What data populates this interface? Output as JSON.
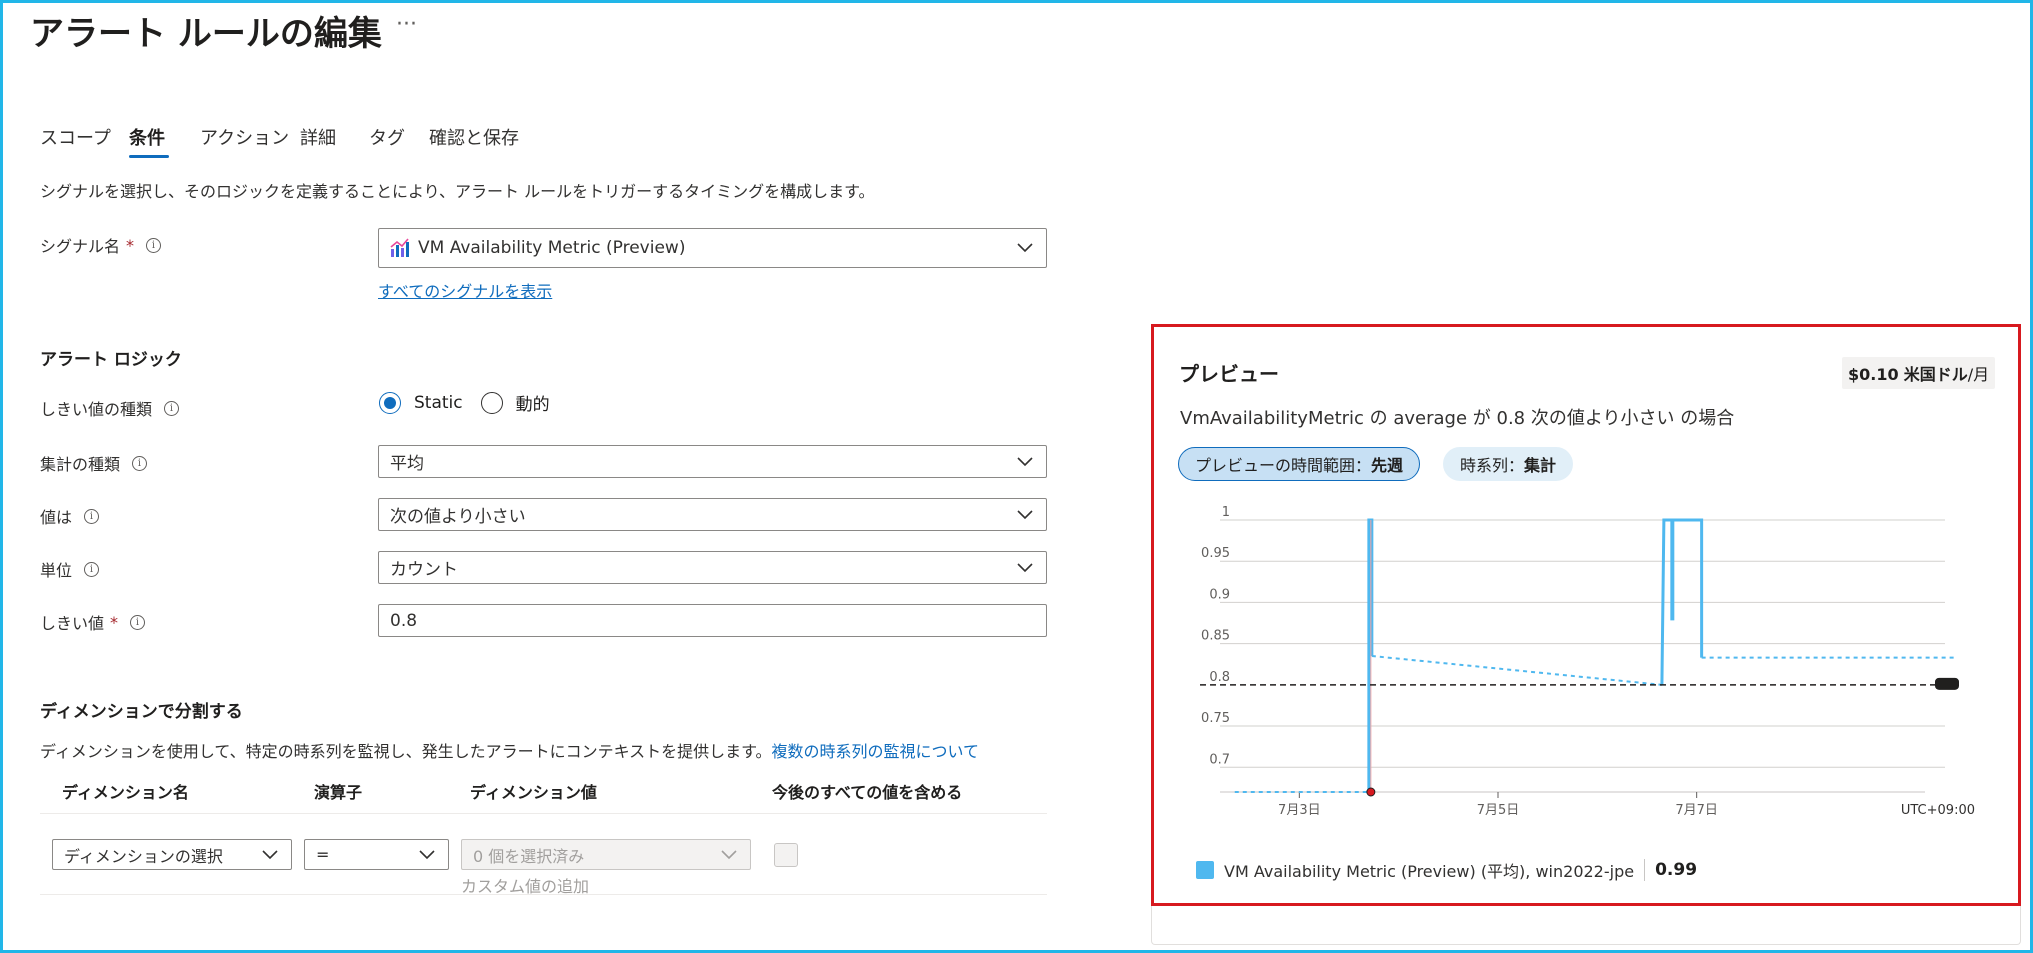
{
  "header": {
    "title": "アラート ルールの編集",
    "more": "···"
  },
  "tabs": [
    {
      "label": "スコープ"
    },
    {
      "label": "条件"
    },
    {
      "label": "アクション"
    },
    {
      "label": "詳細"
    },
    {
      "label": "タグ"
    },
    {
      "label": "確認と保存"
    }
  ],
  "intro": "シグナルを選択し、そのロジックを定義することにより、アラート ルールをトリガーするタイミングを構成します。",
  "signal": {
    "label": "シグナル名",
    "required": "*",
    "value": "VM Availability Metric (Preview)",
    "link": "すべてのシグナルを表示"
  },
  "alert_logic": {
    "heading": "アラート ロジック",
    "threshold_type": {
      "label": "しきい値の種類",
      "options": [
        "Static",
        "動的"
      ],
      "selected": "Static"
    },
    "aggregation": {
      "label": "集計の種類",
      "value": "平均"
    },
    "operator": {
      "label": "値は",
      "value": "次の値より小さい"
    },
    "unit": {
      "label": "単位",
      "value": "カウント"
    },
    "threshold": {
      "label": "しきい値",
      "required": "*",
      "value": "0.8"
    }
  },
  "dimensions": {
    "heading": "ディメンションで分割する",
    "description": "ディメンションを使用して、特定の時系列を監視し、発生したアラートにコンテキストを提供します。",
    "link": "複数の時系列の監視について",
    "columns": [
      "ディメンション名",
      "演算子",
      "ディメンション値",
      "今後のすべての値を含める"
    ],
    "row": {
      "name_placeholder": "ディメンションの選択",
      "operator": "=",
      "value_placeholder": "0 個を選択済み",
      "custom_value": "カスタム値の追加"
    }
  },
  "preview": {
    "title": "プレビュー",
    "price_amount": "$0.10",
    "price_unit": "米国ドル",
    "price_suffix": "/月",
    "condition": "VmAvailabilityMetric の average が 0.8 次の値より小さい の場合",
    "time_range_label": "プレビューの時間範囲：",
    "time_range_value": "先週",
    "series_label": "時系列：",
    "series_value": "集計",
    "legend_label": "VM Availability Metric (Preview) (平均), win2022-jpe",
    "legend_value": "0.99",
    "colors": {
      "series": "#4fb8ef",
      "threshold": "#201f1e",
      "accent": "#0f6cbd",
      "highlight": "#d7191f"
    }
  },
  "chart_data": {
    "type": "line",
    "y_ticks": [
      "1",
      "0.95",
      "0.9",
      "0.85",
      "0.8",
      "0.75",
      "0.7"
    ],
    "x_ticks": [
      "7月3日",
      "7月5日",
      "7月7日"
    ],
    "timezone_label": "UTC+09:00",
    "ylim": [
      0.67,
      1.0
    ],
    "threshold": 0.8,
    "series": [
      {
        "name": "VM Availability Metric (Preview) (平均), win2022-jpe",
        "segments": [
          {
            "style": "dashed",
            "points": [
              [
                2.35,
                0.67
              ],
              [
                3.7,
                0.67
              ]
            ]
          },
          {
            "style": "solid",
            "points": [
              [
                3.7,
                0.67
              ],
              [
                3.7,
                1.0
              ],
              [
                3.73,
                1.0
              ],
              [
                3.73,
                0.835
              ]
            ]
          },
          {
            "style": "dashed",
            "points": [
              [
                3.73,
                0.835
              ],
              [
                6.65,
                0.8
              ]
            ]
          },
          {
            "style": "solid",
            "points": [
              [
                6.65,
                0.8
              ],
              [
                6.67,
                1.0
              ],
              [
                6.75,
                1.0
              ],
              [
                6.75,
                0.88
              ],
              [
                6.76,
                0.88
              ],
              [
                6.76,
                1.0
              ],
              [
                7.05,
                1.0
              ],
              [
                7.05,
                0.833
              ]
            ]
          },
          {
            "style": "dashed",
            "points": [
              [
                7.05,
                0.833
              ],
              [
                9.6,
                0.833
              ]
            ]
          }
        ]
      }
    ],
    "grid": true,
    "legend": "bottom-left"
  }
}
